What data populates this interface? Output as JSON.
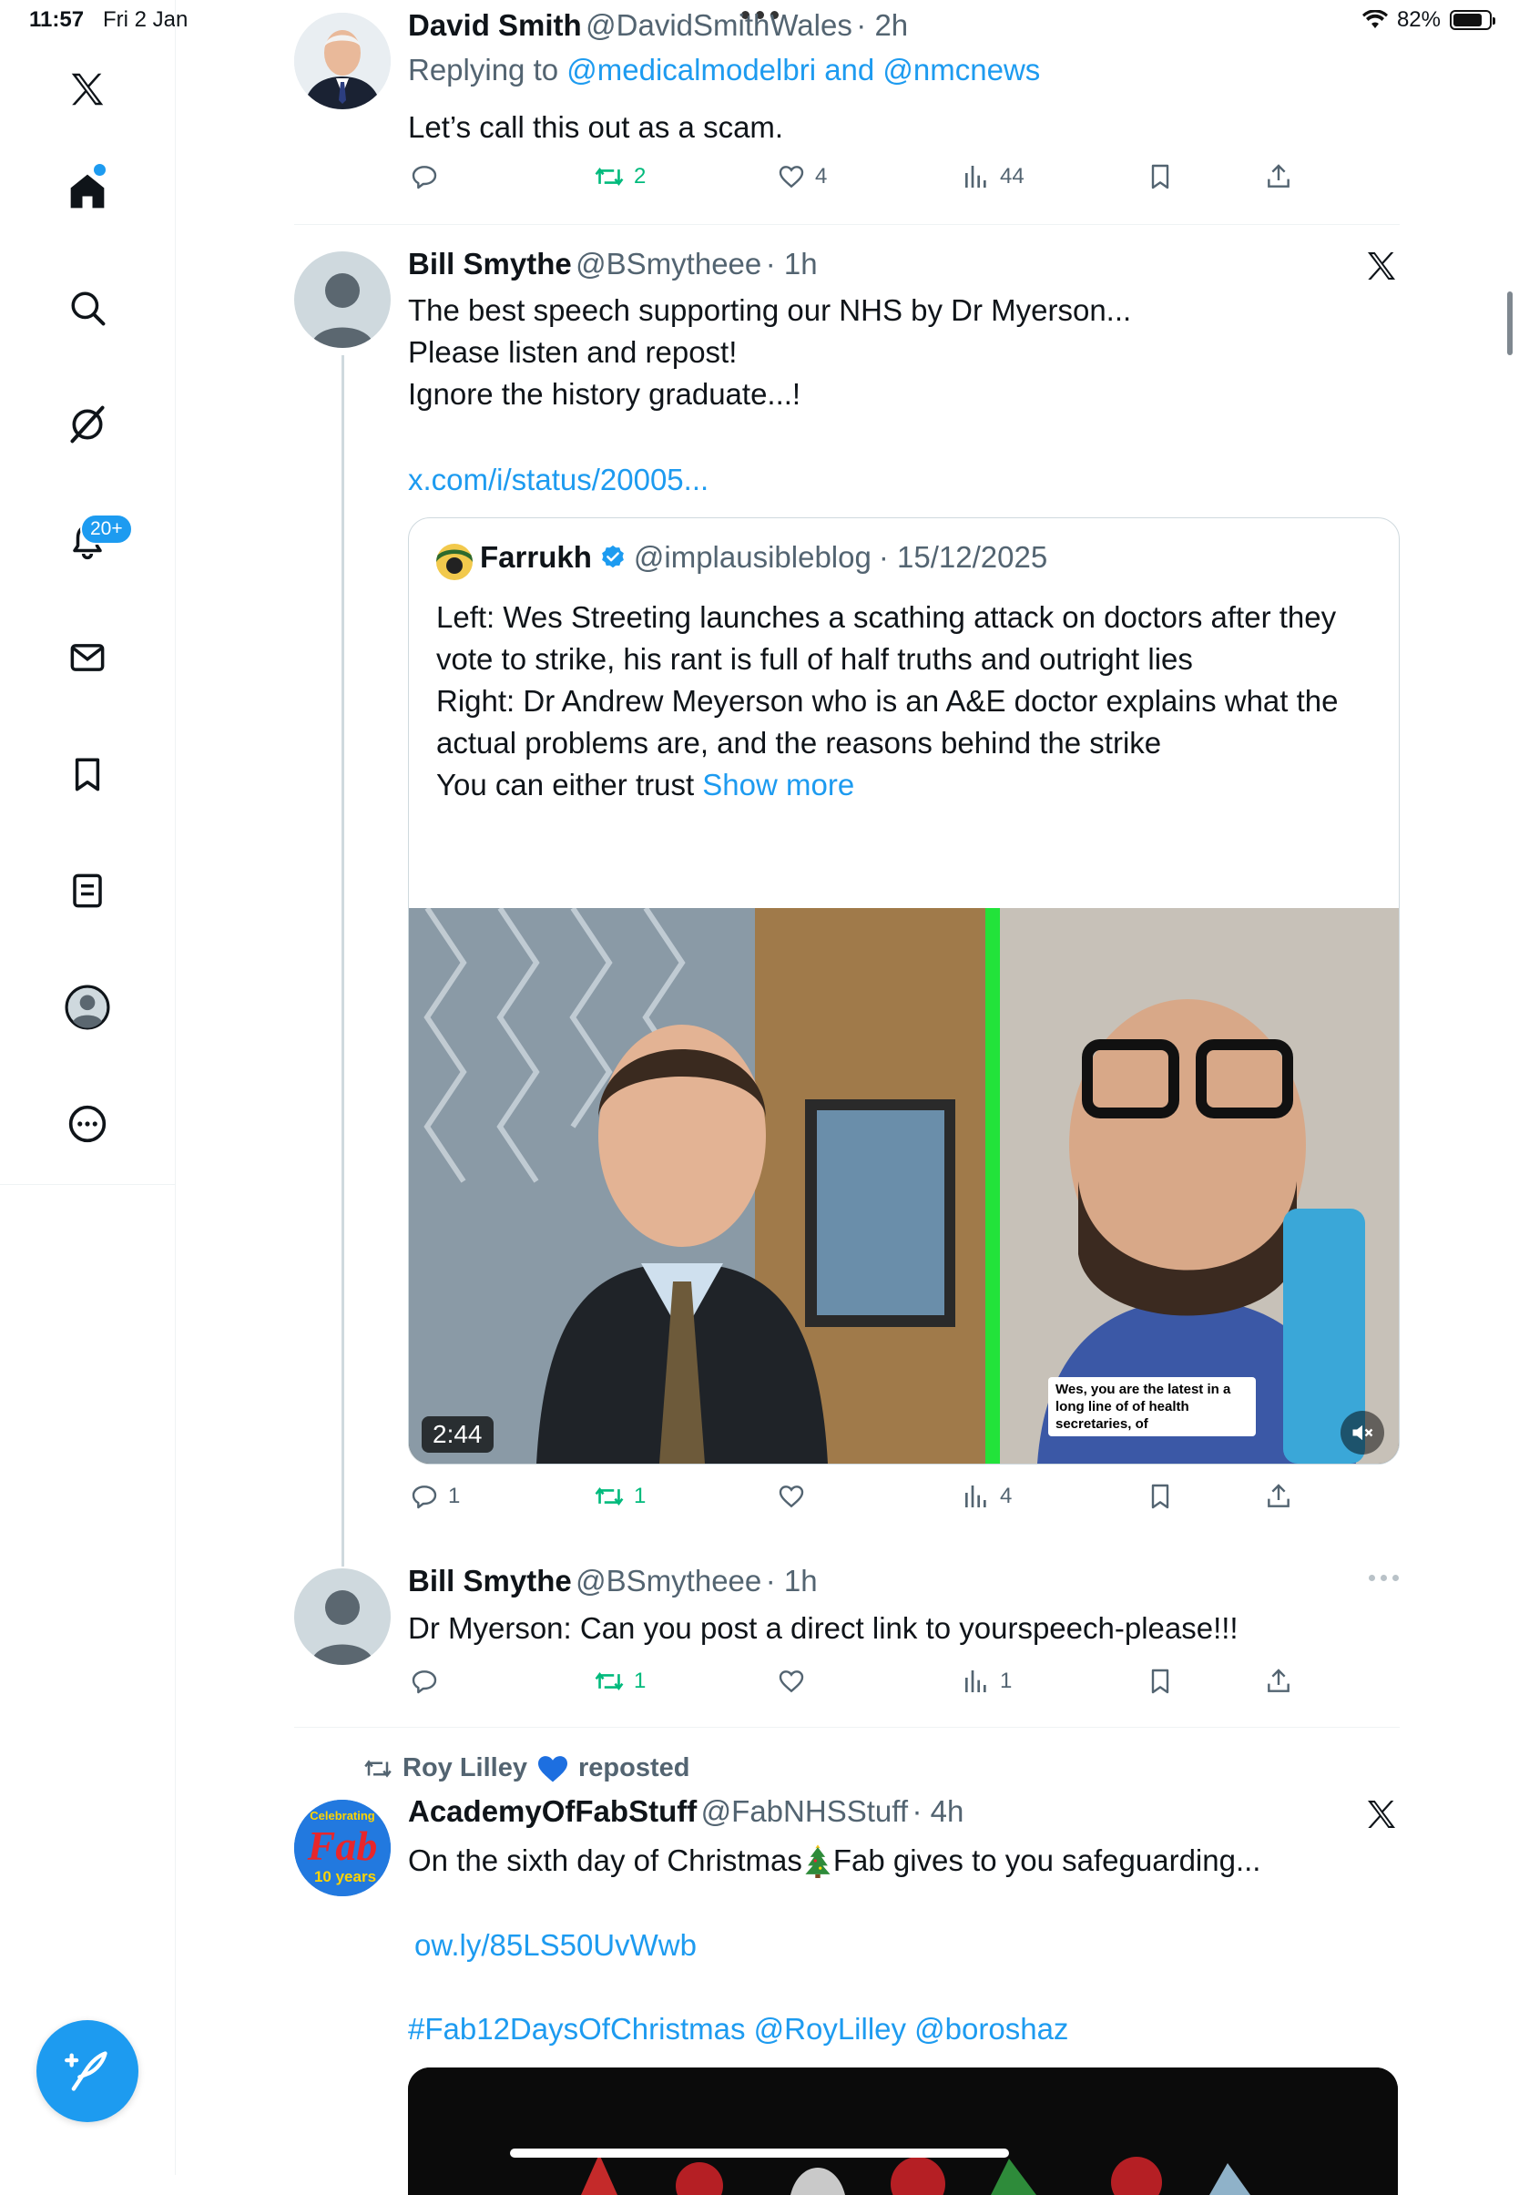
{
  "status_bar": {
    "time": "11:57",
    "date": "Fri 2 Jan",
    "battery": "82%",
    "battery_level": 0.82
  },
  "sidebar": {
    "items": [
      {
        "name": "x-logo-icon"
      },
      {
        "name": "home-icon"
      },
      {
        "name": "search-icon"
      },
      {
        "name": "grok-icon"
      },
      {
        "name": "notifications-icon"
      },
      {
        "name": "messages-icon"
      },
      {
        "name": "bookmarks-icon"
      },
      {
        "name": "lists-icon"
      },
      {
        "name": "profile-icon"
      },
      {
        "name": "more-icon"
      }
    ],
    "notif_badge": "20+"
  },
  "tweets": {
    "t1": {
      "name": "David Smith",
      "handle": "@DavidSmithWales",
      "time": "· 2h",
      "replying_prefix": "Replying to ",
      "replying_to": "@medicalmodelbri and @nmcnews",
      "text": "Let’s call this out as a scam.",
      "reposts": "2",
      "likes": "4",
      "views": "44"
    },
    "t2": {
      "name": "Bill Smythe",
      "handle": "@BSmytheee",
      "time": "· 1h",
      "line1": "The best speech supporting our NHS by Dr Myerson...",
      "line2": "Please listen and repost!",
      "line3": "Ignore the history graduate...!",
      "link": "x.com/i/status/20005...",
      "replies": "1",
      "reposts": "1",
      "views": "4",
      "quote": {
        "name": "Farrukh",
        "handle": "@implausibleblog",
        "date": "· 15/12/2025",
        "p1": "Left: Wes Streeting launches a scathing attack on doctors after they vote to strike, his rant is full of half truths and outright lies",
        "p2": "Right: Dr Andrew Meyerson who is an A&E doctor explains what the actual problems are, and the reasons behind the strike",
        "p3": "You can either trust ",
        "show_more": "Show more",
        "duration": "2:44",
        "caption": "Wes, you are the latest in a long line of of health secretaries, of"
      }
    },
    "t3": {
      "name": "Bill Smythe",
      "handle": "@BSmytheee",
      "time": "· 1h",
      "text": "Dr Myerson: Can you post a direct link to yourspeech-please!!!",
      "reposts": "1",
      "views": "1"
    },
    "t4": {
      "reposted_by": "Roy Lilley",
      "reposted_suffix": "reposted",
      "name": "AcademyOfFabStuff",
      "handle": "@FabNHSStuff",
      "time": "· 4h",
      "text_a": "On the sixth day of Christmas ",
      "text_b": " Fab gives to you safeguarding...",
      "link": "ow.ly/85LS50UvWwb",
      "hashtags": "#Fab12DaysOfChristmas @RoyLilley @boroshaz",
      "avatar_text1": "Celebrating",
      "avatar_text2": "Fab",
      "avatar_text3": "10 years"
    }
  },
  "colors": {
    "accent": "#1d9bf0",
    "repost_green": "#00ba7c",
    "muted": "#536471"
  }
}
